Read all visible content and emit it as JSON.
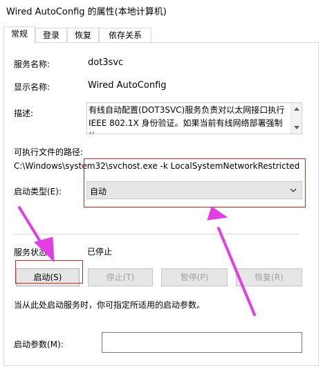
{
  "window": {
    "title": "Wired AutoConfig 的属性(本地计算机)"
  },
  "tabs": [
    {
      "label": "常规"
    },
    {
      "label": "登录"
    },
    {
      "label": "恢复"
    },
    {
      "label": "依存关系"
    }
  ],
  "general": {
    "service_name_label": "服务名称:",
    "service_name": "dot3svc",
    "display_name_label": "显示名称:",
    "display_name": "Wired AutoConfig",
    "description_label": "描述:",
    "description": "有线自动配置(DOT3SVC)服务负责对以太网接口执行 IEEE 802.1X 身份验证。如果当前有线网络部署强制执",
    "exe_path_label": "可执行文件的路径:",
    "exe_path": "C:\\Windows\\system32\\svchost.exe -k LocalSystemNetworkRestricted",
    "startup_type_label": "启动类型(E):",
    "startup_type": "自动",
    "status_label": "服务状态:",
    "status": "已停止",
    "buttons": {
      "start": "启动(S)",
      "stop": "停止(T)",
      "pause": "暂停(P)",
      "resume": "恢复(R)"
    },
    "hint": "当从此处启动服务时，你可指定所适用的启动参数。",
    "params_label": "启动参数(M):",
    "params_value": ""
  },
  "annotation_color": "#e8211c",
  "arrow_color": "#e23ee8"
}
